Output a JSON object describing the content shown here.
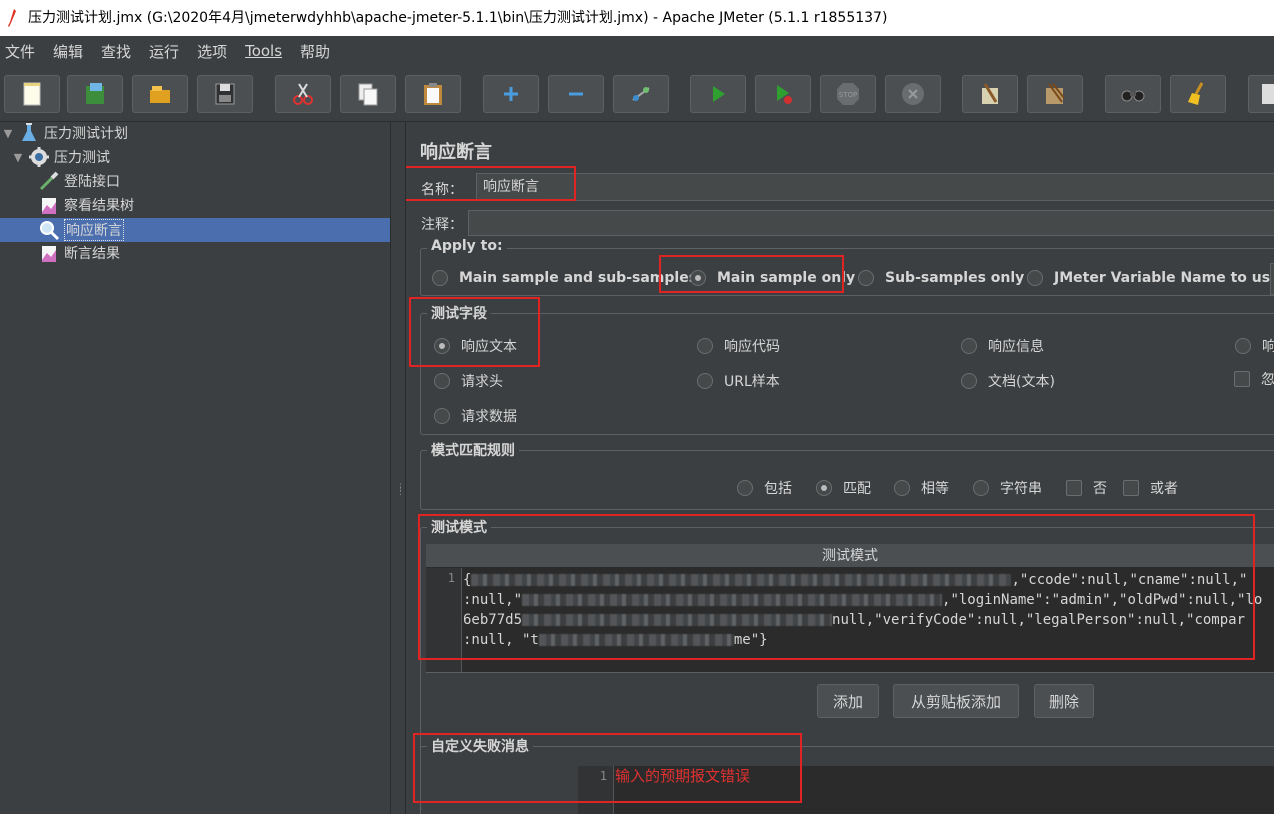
{
  "window": {
    "title": "压力测试计划.jmx (G:\\2020年4月\\jmeterwdyhhb\\apache-jmeter-5.1.1\\bin\\压力测试计划.jmx) - Apache JMeter (5.1.1 r1855137)"
  },
  "menu": [
    "文件",
    "编辑",
    "查找",
    "运行",
    "选项",
    "Tools",
    "帮助"
  ],
  "toolbar": {
    "buttons": [
      "new-icon",
      "templates-icon",
      "open-icon",
      "save-icon",
      "cut-icon",
      "copy-icon",
      "paste-icon",
      "expand-icon",
      "collapse-icon",
      "toggle-icon",
      "start-icon",
      "start-no-pause-icon",
      "stop-icon",
      "shutdown-icon",
      "clear-icon",
      "clear-all-icon",
      "search-icon",
      "reset-search-icon",
      "function-helper-icon"
    ]
  },
  "tree": {
    "items": [
      {
        "label": "压力测试计划",
        "icon": "test-plan-icon"
      },
      {
        "label": "压力测试",
        "icon": "thread-group-icon"
      },
      {
        "label": "登陆接口",
        "icon": "http-sampler-icon"
      },
      {
        "label": "察看结果树",
        "icon": "listener-icon"
      },
      {
        "label": "响应断言",
        "icon": "assertion-icon"
      },
      {
        "label": "断言结果",
        "icon": "listener-icon"
      }
    ]
  },
  "panel": {
    "title": "响应断言",
    "name_label": "名称：",
    "name_value": "响应断言",
    "comment_label": "注释："
  },
  "apply_to": {
    "title": "Apply to:",
    "options": [
      "Main sample and sub-samples",
      "Main sample only",
      "Sub-samples only",
      "JMeter Variable Name to use"
    ],
    "selected": "Main sample only"
  },
  "test_field": {
    "title": "测试字段",
    "options": [
      "响应文本",
      "响应代码",
      "响应信息",
      "响",
      "请求头",
      "URL样本",
      "文档(文本)",
      "请求数据"
    ],
    "checkbox": "忽",
    "selected": "响应文本"
  },
  "pattern_rules": {
    "title": "模式匹配规则",
    "radios": [
      "包括",
      "匹配",
      "相等",
      "字符串"
    ],
    "checkboxes": [
      "否",
      "或者"
    ],
    "selected": "匹配"
  },
  "test_pattern": {
    "title": "测试模式",
    "column_header": "测试模式",
    "line_number": "1",
    "code_visible": [
      ",\"ccode\":null,\"cname\":null,\"",
      ",\"loginName\":\"admin\",\"oldPwd\":null,\"lo",
      "null,\"verifyCode\":null,\"legalPerson\":null,\"compar",
      "me\"}"
    ],
    "code_prefix": [
      ":null,\"",
      "6eb77d5",
      ":null, \"t"
    ],
    "code_start": "{"
  },
  "buttons": {
    "add": "添加",
    "add_from_clipboard": "从剪贴板添加",
    "delete": "删除"
  },
  "failure_message": {
    "title": "自定义失败消息",
    "line_number": "1",
    "value": "输入的预期报文错误"
  },
  "colors": {
    "background": "#3c3f41",
    "selection": "#4b6eaf",
    "highlight_box": "#e02424",
    "failure_text": "#e03030"
  }
}
